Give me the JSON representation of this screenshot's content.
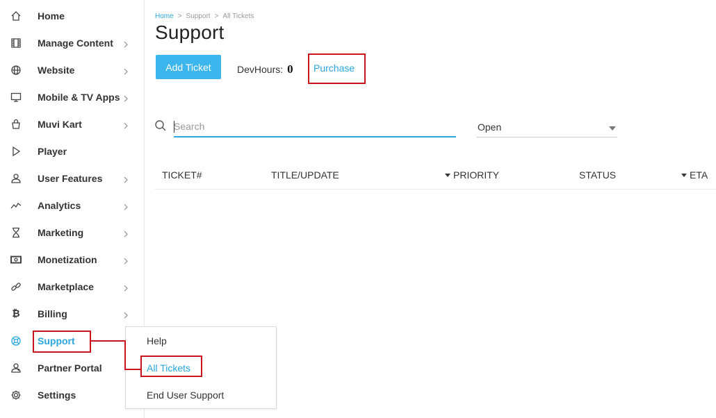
{
  "sidebar": {
    "items": [
      {
        "label": "Home",
        "icon": "home-icon",
        "chevron": false
      },
      {
        "label": "Manage Content",
        "icon": "film-icon",
        "chevron": true
      },
      {
        "label": "Website",
        "icon": "globe-icon",
        "chevron": true
      },
      {
        "label": "Mobile & TV Apps",
        "icon": "monitor-icon",
        "chevron": true
      },
      {
        "label": "Muvi Kart",
        "icon": "shopping-bag-icon",
        "chevron": true
      },
      {
        "label": "Player",
        "icon": "play-icon",
        "chevron": false
      },
      {
        "label": "User Features",
        "icon": "user-icon",
        "chevron": true
      },
      {
        "label": "Analytics",
        "icon": "analytics-icon",
        "chevron": true
      },
      {
        "label": "Marketing",
        "icon": "hourglass-icon",
        "chevron": true
      },
      {
        "label": "Monetization",
        "icon": "money-icon",
        "chevron": true
      },
      {
        "label": "Marketplace",
        "icon": "link-icon",
        "chevron": true
      },
      {
        "label": "Billing",
        "icon": "bitcoin-icon",
        "chevron": true
      },
      {
        "label": "Support",
        "icon": "lifebuoy-icon",
        "chevron": false,
        "active": true
      },
      {
        "label": "Partner Portal",
        "icon": "partner-icon",
        "chevron": false
      },
      {
        "label": "Settings",
        "icon": "gear-icon",
        "chevron": false
      }
    ]
  },
  "submenu": {
    "items": [
      {
        "label": "Help"
      },
      {
        "label": "All Tickets",
        "active": true
      },
      {
        "label": "End User Support"
      }
    ]
  },
  "breadcrumb": {
    "home": "Home",
    "sep": ">",
    "section": "Support",
    "current": "All Tickets"
  },
  "page": {
    "title": "Support",
    "add_ticket_label": "Add Ticket",
    "devhours_label": "DevHours:",
    "devhours_value": "0",
    "purchase_label": "Purchase"
  },
  "search": {
    "placeholder": "Search",
    "value": ""
  },
  "status_filter": {
    "selected": "Open"
  },
  "table": {
    "columns": [
      "TICKET#",
      "TITLE/UPDATE",
      "PRIORITY",
      "STATUS",
      "ETA"
    ]
  },
  "colors": {
    "accent": "#2ba6de",
    "button": "#3cb6ec",
    "annotation": "#c9141e"
  }
}
